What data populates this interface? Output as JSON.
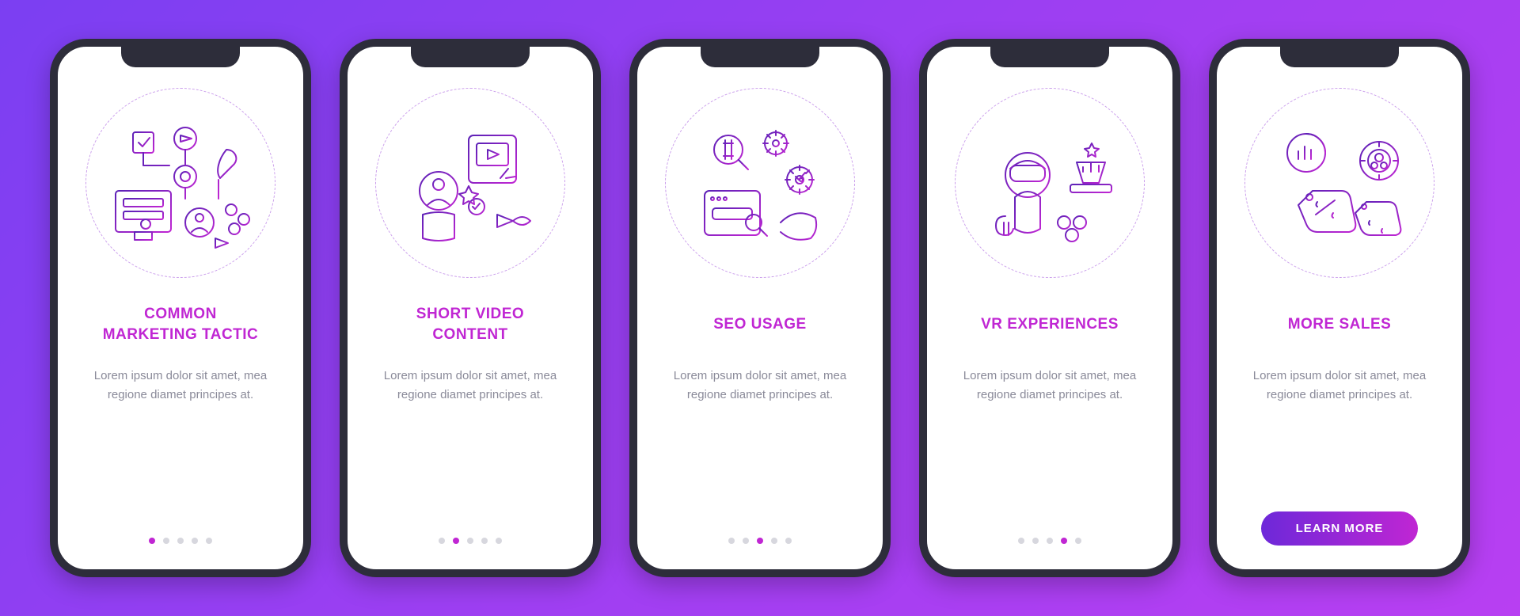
{
  "background_gradient": [
    "#7b3ff2",
    "#9d3ff2",
    "#b83ff2"
  ],
  "accent": "#c026d3",
  "body_text": "Lorem ipsum dolor sit amet, mea regione diamet principes at.",
  "cta_label": "LEARN MORE",
  "screens": [
    {
      "title": "COMMON\nMARKETING TACTIC",
      "icon": "marketing-tactic-icon",
      "active_index": 0
    },
    {
      "title": "SHORT VIDEO\nCONTENT",
      "icon": "short-video-icon",
      "active_index": 1
    },
    {
      "title": "SEO USAGE",
      "icon": "seo-usage-icon",
      "active_index": 2
    },
    {
      "title": "VR EXPERIENCES",
      "icon": "vr-experiences-icon",
      "active_index": 3
    },
    {
      "title": "MORE SALES",
      "icon": "more-sales-icon",
      "active_index": 4
    }
  ]
}
